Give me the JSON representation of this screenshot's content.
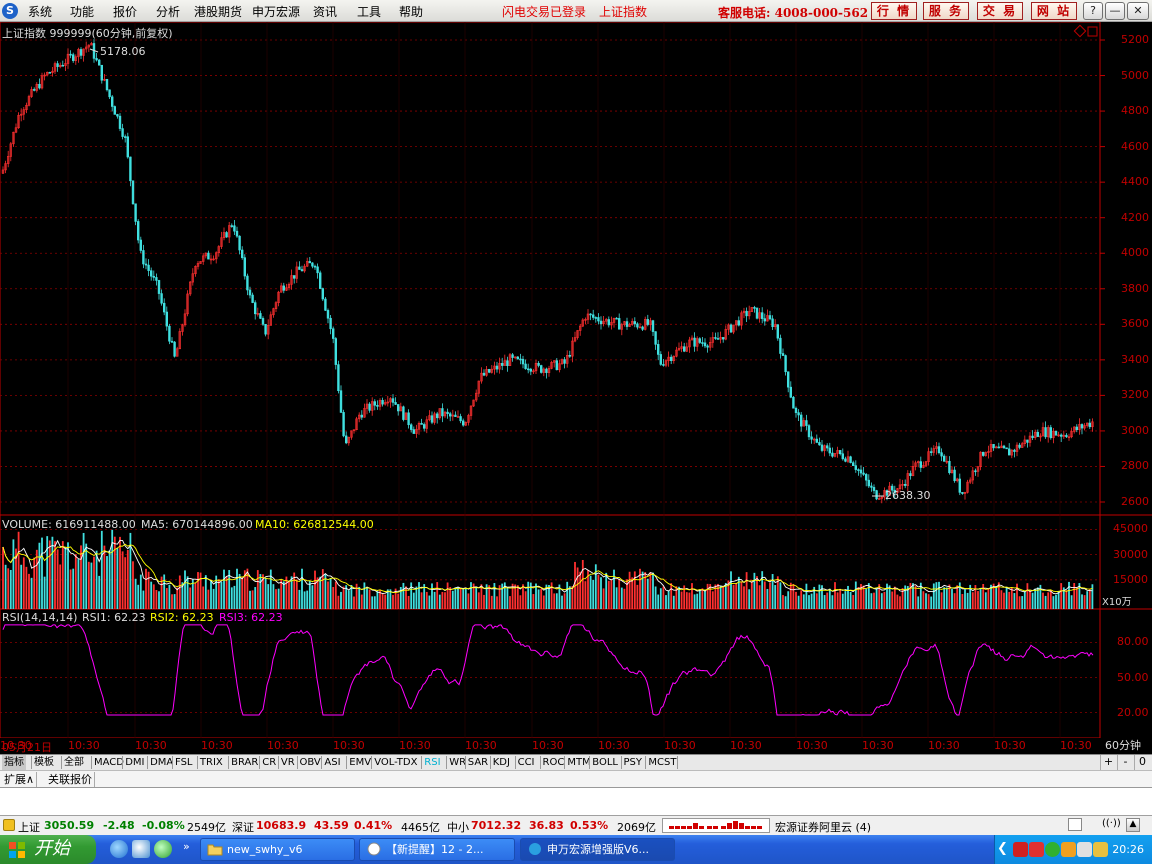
{
  "menubar": {
    "items": [
      "系统",
      "功能",
      "报价",
      "分析",
      "港股期货",
      "申万宏源",
      "资讯",
      "工具",
      "帮助"
    ],
    "status_login": "闪电交易已登录",
    "status_index": "上证指数",
    "hotline": "客服电话: 4008-000-562",
    "buttons": [
      "行 情",
      "服 务",
      "交 易",
      "网 站"
    ],
    "window_controls": [
      "?",
      "—",
      "❐",
      "✕"
    ]
  },
  "chart": {
    "main_title": "上证指数 999999(60分钟,前复权)",
    "max_label": "5178.06",
    "min_label": "2638.30",
    "price_axis": [
      "5200",
      "5000",
      "4800",
      "4600",
      "4400",
      "4200",
      "4000",
      "3800",
      "3600",
      "3400",
      "3200",
      "3000",
      "2800",
      "2600"
    ],
    "volume_header": {
      "volume": "VOLUME: 616911488.00",
      "ma5": "MA5: 670144896.00",
      "ma10": "MA10: 626812544.00"
    },
    "volume_axis": [
      "45000",
      "30000",
      "15000"
    ],
    "volume_unit": "X10万",
    "rsi_header": {
      "name": "RSI(14,14,14)",
      "rsi1": "RSI1: 62.23",
      "rsi2": "RSI2: 62.23",
      "rsi3": "RSI3: 62.23"
    },
    "rsi_axis": [
      "80.00",
      "50.00",
      "20.00"
    ],
    "time_labels": [
      "05月21日",
      "10:30",
      "10:30",
      "10:30",
      "10:30",
      "10:30",
      "10:30",
      "10:30",
      "10:30",
      "10:30",
      "10:30",
      "10:30",
      "10:30",
      "10:30",
      "10:30",
      "10:30",
      "10:30",
      "10:30"
    ],
    "period": "60分钟",
    "colors": {
      "up": "#ff3030",
      "down": "#40e0e0",
      "ma5": "#ffffff",
      "ma10": "#ffff00",
      "rsi": "#ff00ff",
      "grid": "#8b0000",
      "axis": "#c00000"
    }
  },
  "indicator_tabs": [
    "指标",
    "模板",
    "全部",
    "MACD",
    "DMI",
    "DMA",
    "FSL",
    "TRIX",
    "BRAR",
    "CR",
    "VR",
    "OBV",
    "ASI",
    "EMV",
    "VOL-TDX",
    "RSI",
    "WR",
    "SAR",
    "KDJ",
    "CCI",
    "ROC",
    "MTM",
    "BOLL",
    "PSY",
    "MCST"
  ],
  "active_tab": "RSI",
  "tab_controls": [
    "+",
    "-",
    "0"
  ],
  "ext_tabs": [
    "扩展∧",
    "关联报价"
  ],
  "statusbar": {
    "sh_label": "上证",
    "sh_value": "3050.59",
    "sh_change": "-2.48",
    "sh_pct": "-0.08%",
    "sh_amount": "2549亿",
    "sz_label": "深证",
    "sz_value": "10683.9",
    "sz_change": "43.59",
    "sz_pct": "0.41%",
    "sz_amount": "4465亿",
    "zx_label": "中小",
    "zx_value": "7012.32",
    "zx_change": "36.83",
    "zx_pct": "0.53%",
    "zx_amount": "2069亿",
    "broker": "宏源证券阿里云 (4)"
  },
  "taskbar": {
    "start": "开始",
    "tasks": [
      "new_swhy_v6",
      "【新提醒】12 - 2...",
      "申万宏源增强版V6..."
    ],
    "clock": "20:26"
  }
}
